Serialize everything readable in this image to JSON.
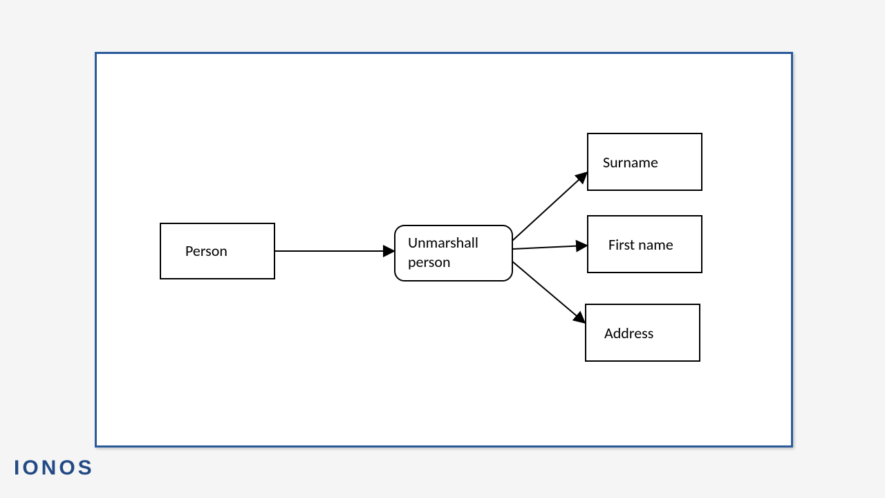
{
  "diagram": {
    "input_node": "Person",
    "process_node_line1": "Unmarshall",
    "process_node_line2": "person",
    "output_nodes": {
      "top": "Surname",
      "middle": "First name",
      "bottom": "Address"
    }
  },
  "branding": {
    "logo_text": "IONOS"
  },
  "colors": {
    "frame_border": "#2a5a9a",
    "page_bg": "#f5f5f5",
    "box_border": "#000000"
  }
}
